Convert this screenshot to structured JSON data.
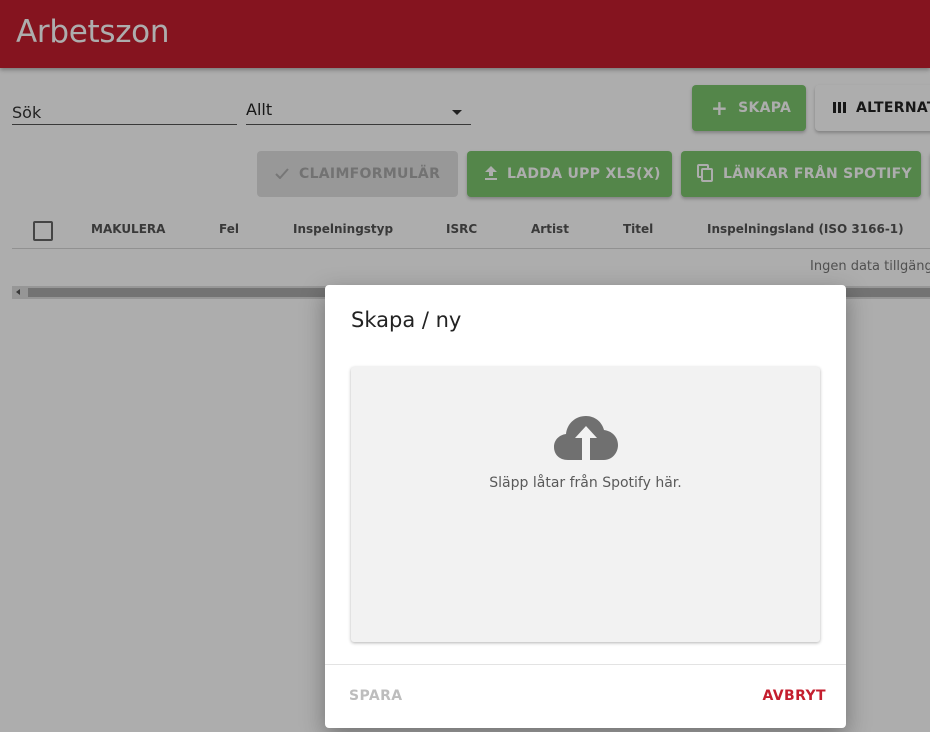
{
  "app": {
    "title": "Arbetszon",
    "brand_color": "#c41e2e"
  },
  "filters": {
    "search_placeholder": "Sök",
    "category_value": "Allt"
  },
  "toolbar": {
    "create_label": "SKAPA",
    "create_icon": "plus-icon",
    "columns_label": "ALTERNAT",
    "columns_icon": "columns-icon",
    "claimform_label": "CLAIMFORMULÄR",
    "claimform_icon": "check-icon",
    "upload_label": "LADDA UPP XLS(X)",
    "upload_icon": "upload-icon",
    "spotify_label": "LÄNKAR FRÅN SPOTIFY",
    "spotify_icon": "copy-icon",
    "accent_color": "#7cc66e"
  },
  "table": {
    "columns": [
      "MAKULERA",
      "Fel",
      "Inspelningstyp",
      "ISRC",
      "Artist",
      "Titel",
      "Inspelningsland (ISO 3166-1)"
    ],
    "empty_text": "Ingen data tillgäng"
  },
  "dialog": {
    "title": "Skapa / ny",
    "dropzone_text": "Släpp låtar från Spotify här.",
    "dropzone_icon": "cloud-upload-icon",
    "save_label": "SPARA",
    "cancel_label": "AVBRYT",
    "cancel_color": "#c41e2e"
  }
}
